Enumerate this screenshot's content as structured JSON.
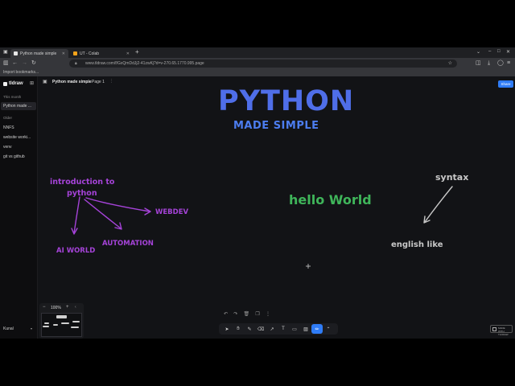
{
  "browser": {
    "tabs": [
      {
        "title": "Python made simple",
        "active": true
      },
      {
        "title": "UT - Colab",
        "active": false
      }
    ],
    "new_tab": "+",
    "url": "www.tldraw.com/f/GxQmDdJj2-41zwKj?d=v-270.65.1770.995.page",
    "bookmarks_label": "Import bookmarks..."
  },
  "sidebar": {
    "brand": "tldraw",
    "groups": [
      {
        "label": "This month",
        "items": [
          "Python made ..."
        ]
      },
      {
        "label": "Older",
        "items": [
          "NNFS",
          "website worki...",
          "venv",
          "git vs github"
        ]
      }
    ],
    "user": "Kunal"
  },
  "topbar": {
    "doc_title": "Python made simple",
    "separator": "/",
    "page": "Page 1",
    "share_label": "Share"
  },
  "canvas": {
    "title": "PYTHON",
    "subtitle": "MADE SIMPLE",
    "intro_line1": "introduction to",
    "intro_line2": "python",
    "webdev": "WEBDEV",
    "automation": "AUTOMATION",
    "ai_world": "AI WORLD",
    "hello": "hello World",
    "syntax": "syntax",
    "english": "english like",
    "colors": {
      "title": "#4f6ee8",
      "subtitle": "#4c7df0",
      "purple": "#a543d8",
      "green": "#3fb55a",
      "gray": "#c8c8c8"
    }
  },
  "minimap": {
    "zoom": "100%"
  },
  "toolbar": {
    "undo_icons": [
      "undo-icon",
      "redo-icon",
      "trash-icon",
      "duplicate-icon",
      "more-icon"
    ],
    "tools": [
      "select-icon",
      "hand-icon",
      "pencil-icon",
      "eraser-icon",
      "arrow-icon",
      "text-icon",
      "note-icon",
      "asset-icon",
      "draw-icon",
      "chevron-up-icon"
    ]
  },
  "badge": {
    "line1": "MADE WITH",
    "line2": "TLDRAW"
  }
}
